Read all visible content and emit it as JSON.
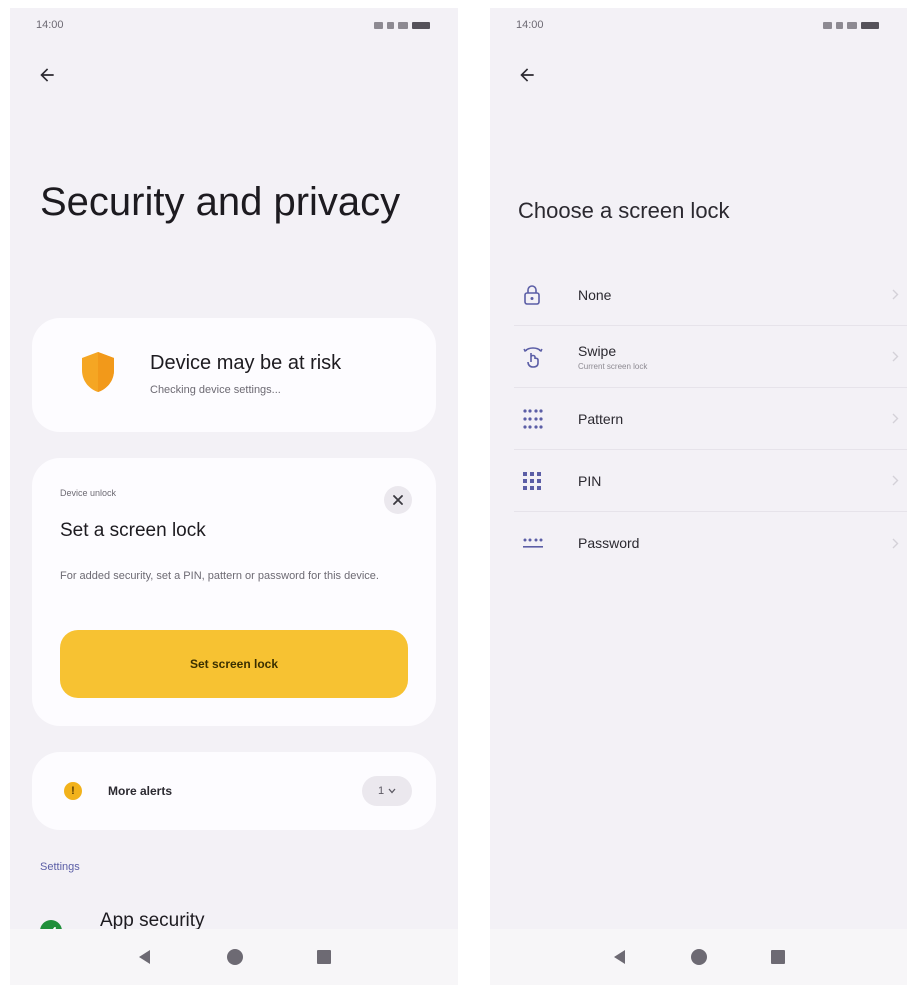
{
  "left_screen": {
    "status": {
      "time": "14:00"
    },
    "title": "Security and privacy",
    "risk_card": {
      "title": "Device may be at risk",
      "subtitle": "Checking device settings..."
    },
    "lock_card": {
      "overline": "Device unlock",
      "title": "Set a screen lock",
      "description": "For added security, set a PIN, pattern or password for this device.",
      "button_label": "Set screen lock"
    },
    "alerts": {
      "label": "More alerts",
      "count": "1",
      "icon_glyph": "!"
    },
    "section_header": "Settings",
    "app_security": {
      "label": "App security"
    }
  },
  "right_screen": {
    "status": {
      "time": "14:00"
    },
    "title": "Choose a screen lock",
    "options": [
      {
        "label": "None",
        "subtitle": "",
        "icon": "lock-open-icon"
      },
      {
        "label": "Swipe",
        "subtitle": "Current screen lock",
        "icon": "swipe-icon"
      },
      {
        "label": "Pattern",
        "subtitle": "",
        "icon": "pattern-icon"
      },
      {
        "label": "PIN",
        "subtitle": "",
        "icon": "pin-icon"
      },
      {
        "label": "Password",
        "subtitle": "",
        "icon": "password-icon"
      }
    ]
  },
  "colors": {
    "background": "#f3f1f6",
    "card": "#fdfcff",
    "accent_yellow": "#f7c232",
    "shield_orange": "#f5a623",
    "icon_purple": "#5b5ea6",
    "success_green": "#1f8f3a"
  }
}
